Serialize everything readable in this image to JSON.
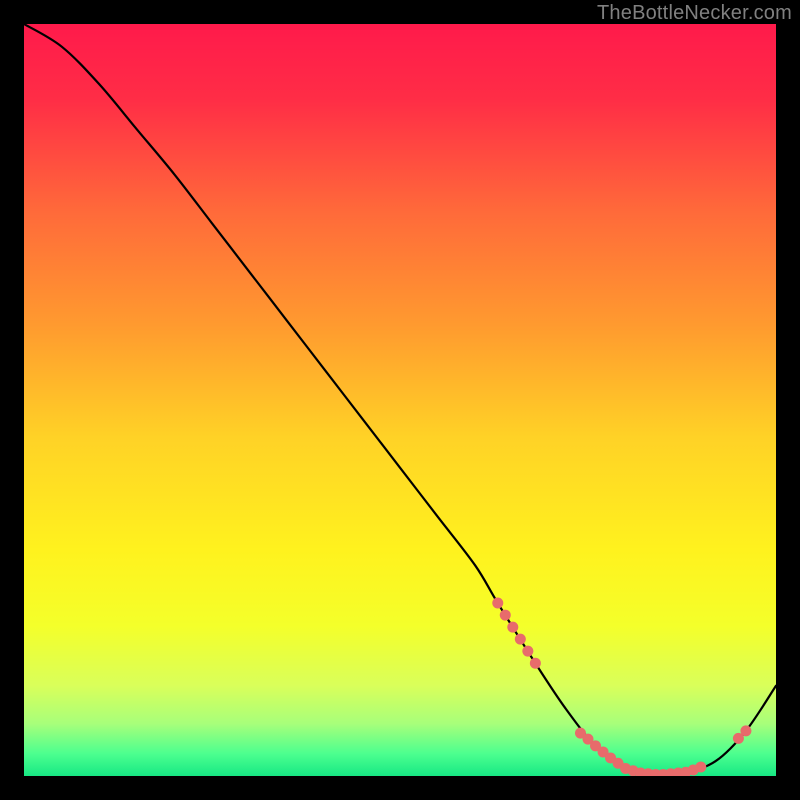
{
  "attribution": "TheBottleNecker.com",
  "chart_data": {
    "type": "line",
    "title": "",
    "xlabel": "",
    "ylabel": "",
    "xlim": [
      0,
      100
    ],
    "ylim": [
      0,
      100
    ],
    "curve": {
      "name": "bottleneck-curve",
      "x": [
        0,
        5,
        10,
        15,
        20,
        25,
        30,
        35,
        40,
        45,
        50,
        55,
        60,
        63,
        68,
        72,
        76,
        80,
        84,
        88,
        92,
        96,
        100
      ],
      "y": [
        100,
        97,
        92,
        86,
        80,
        73.5,
        67,
        60.5,
        54,
        47.5,
        41,
        34.5,
        28,
        23,
        15,
        9,
        4,
        1,
        0.2,
        0.5,
        2,
        6,
        12
      ]
    },
    "markers": {
      "name": "highlight-dots",
      "color": "#e86b6b",
      "x": [
        63,
        64,
        65,
        66,
        67,
        68,
        74,
        75,
        76,
        77,
        78,
        79,
        80,
        81,
        82,
        83,
        84,
        85,
        86,
        87,
        88,
        89,
        90,
        95,
        96
      ],
      "y": [
        23,
        21.4,
        19.8,
        18.2,
        16.6,
        15,
        5.7,
        4.9,
        4.0,
        3.2,
        2.4,
        1.7,
        1.0,
        0.7,
        0.4,
        0.3,
        0.2,
        0.2,
        0.3,
        0.4,
        0.5,
        0.8,
        1.2,
        5.0,
        6.0
      ]
    },
    "background_gradient": {
      "stops": [
        {
          "offset": 0.0,
          "color": "#ff1a4b"
        },
        {
          "offset": 0.1,
          "color": "#ff2d46"
        },
        {
          "offset": 0.25,
          "color": "#ff6a3a"
        },
        {
          "offset": 0.4,
          "color": "#ff9a2f"
        },
        {
          "offset": 0.55,
          "color": "#ffd226"
        },
        {
          "offset": 0.7,
          "color": "#fff21e"
        },
        {
          "offset": 0.8,
          "color": "#f4ff2a"
        },
        {
          "offset": 0.88,
          "color": "#d9ff5a"
        },
        {
          "offset": 0.93,
          "color": "#a8ff7a"
        },
        {
          "offset": 0.97,
          "color": "#4dff8f"
        },
        {
          "offset": 1.0,
          "color": "#17e884"
        }
      ]
    }
  }
}
